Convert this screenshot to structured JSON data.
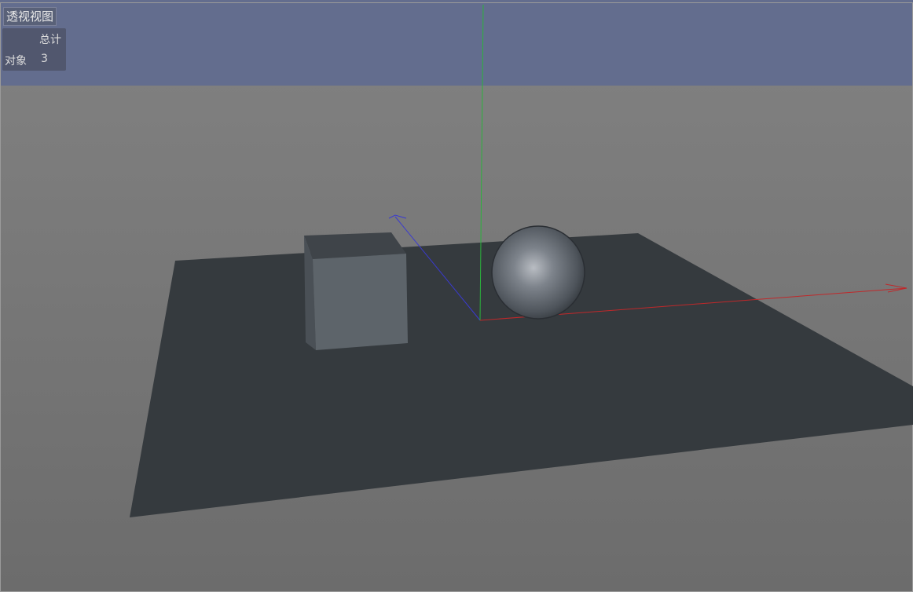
{
  "viewport": {
    "title": "透视视图",
    "stats": {
      "column_header": "总计",
      "row_label": "对象",
      "row_value": "3"
    }
  },
  "scene": {
    "objects": [
      "plane",
      "cube",
      "sphere"
    ],
    "axes": {
      "x_color": "#c0282a",
      "y_color": "#2bb33c",
      "z_color": "#3a3ad0"
    },
    "colors": {
      "sky_band": "#636d8e",
      "background_top": "#808080",
      "background_bottom": "#6e6e6e",
      "plane": "#353a3e",
      "cube_front": "#5d646a",
      "cube_top": "#3f4449"
    }
  }
}
